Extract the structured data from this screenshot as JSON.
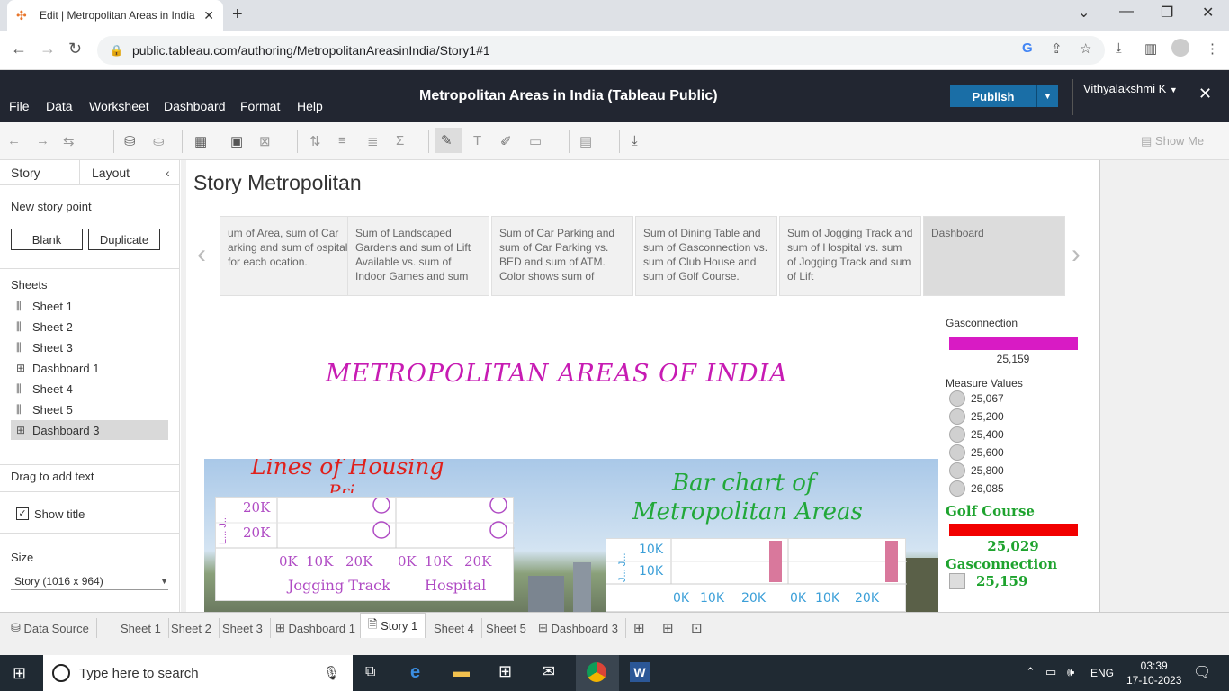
{
  "browser": {
    "tab_title": "Edit | Metropolitan Areas in India",
    "url": "public.tableau.com/authoring/MetropolitanAreasinIndia/Story1#1"
  },
  "header": {
    "menus": [
      "File",
      "Data",
      "Worksheet",
      "Dashboard",
      "Format",
      "Help"
    ],
    "title": "Metropolitan Areas in India (Tableau Public)",
    "publish_label": "Publish",
    "user_name": "Vithyalakshmi K"
  },
  "toolbar": {
    "show_me": "Show Me"
  },
  "leftpane": {
    "tab_story": "Story",
    "tab_layout": "Layout",
    "new_story_point": "New story point",
    "blank_btn": "Blank",
    "duplicate_btn": "Duplicate",
    "sheets_label": "Sheets",
    "sheets": [
      "Sheet 1",
      "Sheet 2",
      "Sheet 3",
      "Dashboard 1",
      "Sheet 4",
      "Sheet 5",
      "Dashboard 3"
    ],
    "drag_text": "Drag to add text",
    "show_title": "Show title",
    "size_label": "Size",
    "size_value": "Story (1016 x 964)"
  },
  "story": {
    "title": "Story Metropolitan",
    "points": [
      "um of Area, sum of Car arking and sum of ospital for each ocation.",
      "Sum of Landscaped Gardens and sum of Lift Available vs. sum of Indoor Games and sum",
      "Sum of Car Parking and sum of Car Parking vs. BED and sum of ATM. Color shows sum of",
      "Sum of Dining Table and sum of Gasconnection vs. sum of Club House and sum of Golf Course.",
      "Sum of Jogging Track and sum of Hospital vs. sum of Jogging Track and sum of Lift",
      "Dashboard"
    ]
  },
  "dashboard": {
    "heading": "METROPOLITAN AREAS OF INDIA",
    "line_title": "Lines of Housing",
    "line_subtitle": "Pri...",
    "line_chart": {
      "y_ticks": [
        "20K",
        "20K"
      ],
      "y_axis_label": "L... J...",
      "x_ticks_1": [
        "0K",
        "10K",
        "20K"
      ],
      "x_ticks_2": [
        "0K",
        "10K",
        "20K"
      ],
      "panel_1_label": "Jogging Track",
      "panel_2_label": "Hospital"
    },
    "bar_title_line1": "Bar chart of",
    "bar_title_line2": "Metropolitan Areas",
    "bar_chart": {
      "y_ticks": [
        "10K",
        "10K"
      ],
      "y_axis_label": "J... J...",
      "x_ticks_1": [
        "0K",
        "10K",
        "20K"
      ],
      "x_ticks_2": [
        "0K",
        "10K",
        "20K"
      ]
    }
  },
  "legend": {
    "gas_title": "Gasconnection",
    "gas_value": "25,159",
    "gas_color": "#d81bc4",
    "mv_title": "Measure Values",
    "mv_items": [
      "25,067",
      "25,200",
      "25,400",
      "25,600",
      "25,800",
      "26,085"
    ],
    "golf_title": "Golf Course",
    "golf_value": "25,029",
    "golf_color": "#f20000",
    "gas2_title": "Gasconnection",
    "gas2_value": "25,159",
    "green": "#1ea32e"
  },
  "bottom_tabs": [
    "Data Source",
    "Sheet 1",
    "Sheet 2",
    "Sheet 3",
    "Dashboard 1",
    "Story 1",
    "Sheet 4",
    "Sheet 5",
    "Dashboard 3"
  ],
  "taskbar": {
    "search_placeholder": "Type here to search",
    "lang": "ENG",
    "time": "03:39",
    "date": "17-10-2023"
  }
}
